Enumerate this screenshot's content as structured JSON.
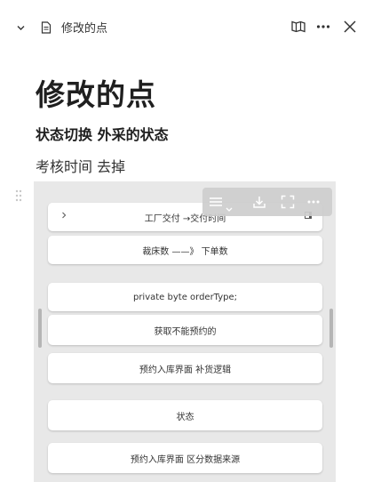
{
  "topbar": {
    "title": "修改的点"
  },
  "document": {
    "title": "修改的点",
    "subtitle": "状态切换 外采的状态",
    "text": "考核时间 去掉"
  },
  "embed": {
    "cards": [
      {
        "label": "工厂交付 →交付时间"
      },
      {
        "label": "裁床数 ——》 下单数"
      },
      {
        "label": "private byte orderType;"
      },
      {
        "label": "获取不能预约的"
      },
      {
        "label": "预约入库界面 补货逻辑"
      },
      {
        "label": "状态"
      },
      {
        "label": "预约入库界面 区分数据来源"
      }
    ]
  },
  "icons": {
    "collapse": "chevron-down-icon",
    "doc": "document-icon",
    "read": "book-icon",
    "more": "more-icon",
    "close": "close-icon"
  }
}
